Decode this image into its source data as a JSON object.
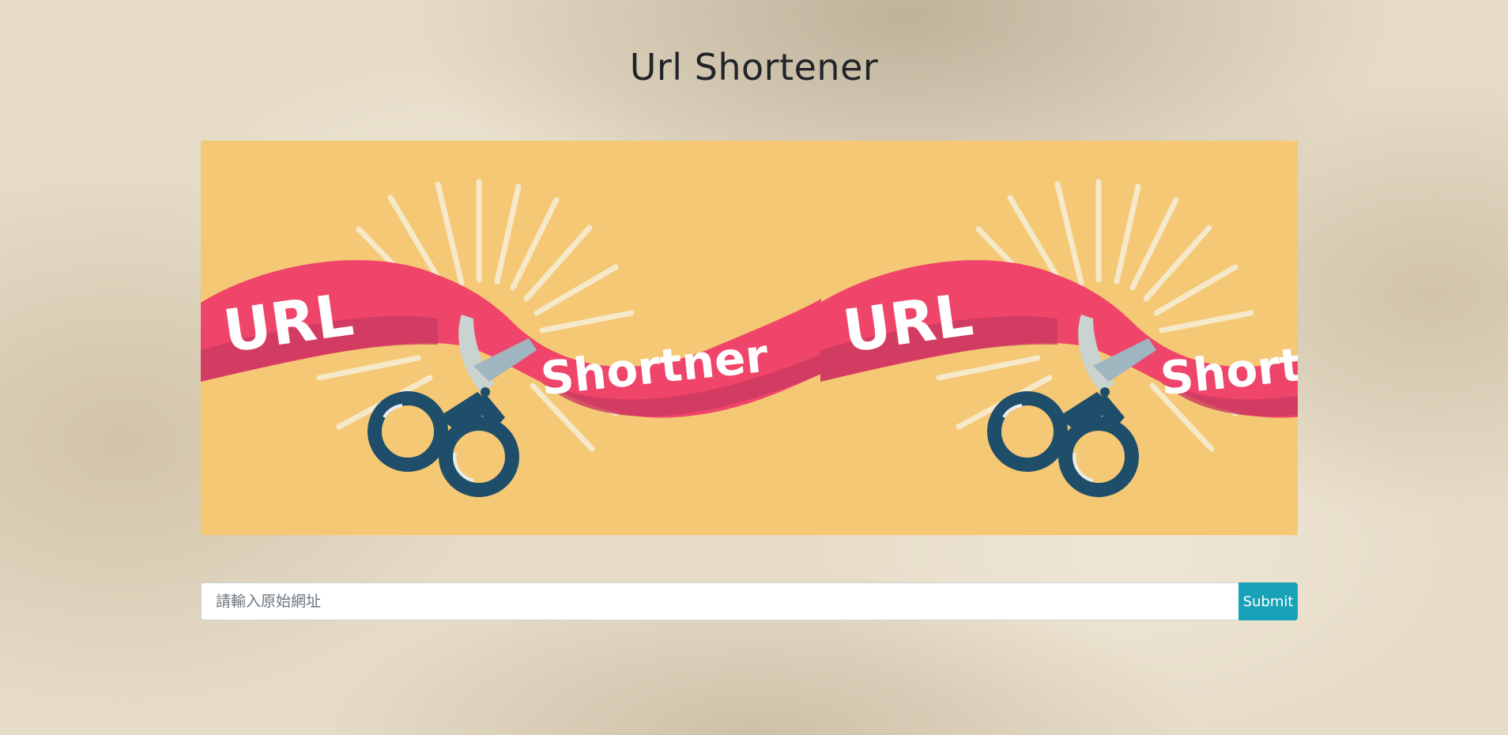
{
  "header": {
    "title": "Url Shortener"
  },
  "banner": {
    "image_name": "url-shortener-banner",
    "word_top": "URL",
    "word_bottom": "Shortner",
    "background_color": "#f4c874",
    "ribbon_color": "#f0456a",
    "scissors_color": "#1f4e6b"
  },
  "form": {
    "url_placeholder": "請輸入原始網址",
    "url_value": "",
    "submit_label": "Submit",
    "accent_color": "#17a2b8"
  }
}
